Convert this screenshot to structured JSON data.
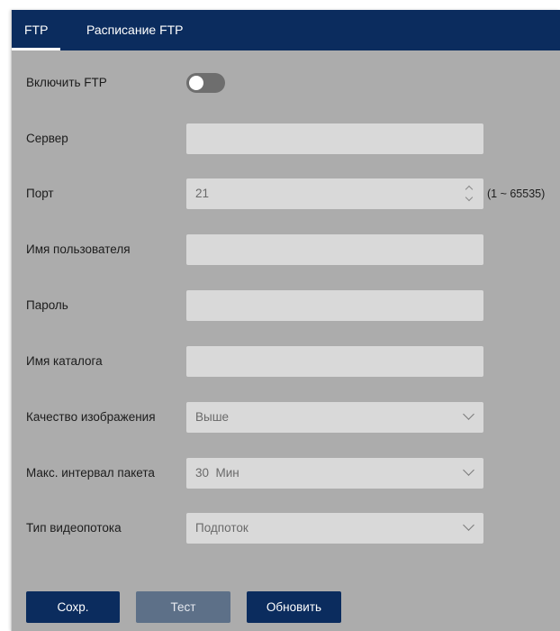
{
  "tabs": {
    "ftp": "FTP",
    "schedule": "Расписание FTP"
  },
  "form": {
    "enable_label": "Включить FTP",
    "enable_state": "off",
    "server_label": "Сервер",
    "server_value": "",
    "port_label": "Порт",
    "port_value": "21",
    "port_range": "(1 ~ 65535)",
    "username_label": "Имя пользователя",
    "username_value": "",
    "password_label": "Пароль",
    "password_value": "",
    "directory_label": "Имя каталога",
    "directory_value": "",
    "quality_label": "Качество изображения",
    "quality_value": "Выше",
    "interval_label": "Макс. интервал пакета",
    "interval_value": "30  Мин",
    "stream_label": "Тип видеопотока",
    "stream_value": "Подпоток"
  },
  "buttons": {
    "save": "Сохр.",
    "test": "Тест",
    "refresh": "Обновить"
  },
  "colors": {
    "header": "#0b2c5e",
    "panel": "#acacac",
    "field": "#d9d9d9",
    "disabled_button": "#5d7088"
  }
}
